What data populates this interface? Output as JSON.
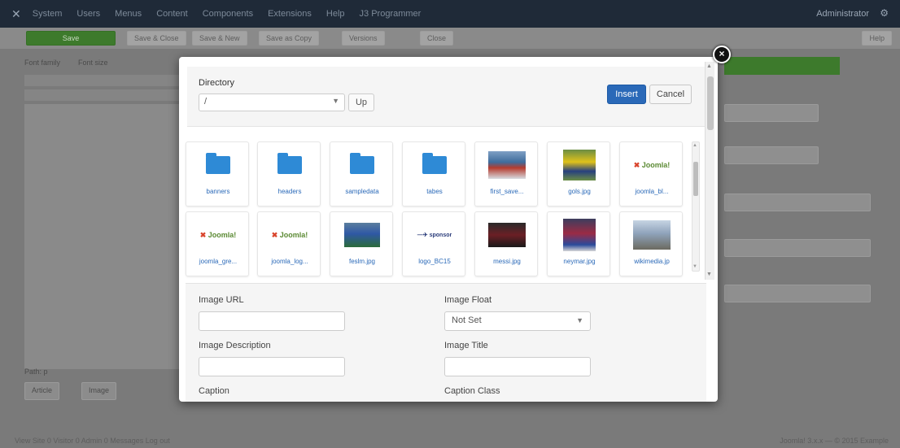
{
  "background": {
    "topbar": {
      "menus": [
        "System",
        "Users",
        "Menus",
        "Content",
        "Components",
        "Extensions",
        "Help",
        "J3 Programmer"
      ],
      "user": "Administrator"
    },
    "toolbar": {
      "save": "Save",
      "save_close": "Save & Close",
      "save_new": "Save & New",
      "save_copy": "Save as Copy",
      "versions": "Versions",
      "close": "Close",
      "help": "Help"
    },
    "editor": {
      "font_family": "Font family",
      "font_size": "Font size",
      "path": "Path: p"
    },
    "bottom_buttons": {
      "article": "Article",
      "image": "Image"
    },
    "footer": {
      "left": "View Site  0 Visitor  0 Admin  0 Messages  Log out",
      "right": "Joomla! 3.x.x — © 2015 Example"
    }
  },
  "modal": {
    "directory_label": "Directory",
    "directory_value": "/",
    "up_label": "Up",
    "insert_label": "Insert",
    "cancel_label": "Cancel",
    "items": [
      {
        "name": "banners",
        "kind": "folder"
      },
      {
        "name": "headers",
        "kind": "folder"
      },
      {
        "name": "sampledata",
        "kind": "folder"
      },
      {
        "name": "tabes",
        "kind": "folder"
      },
      {
        "name": "first_save...",
        "kind": "image",
        "style": "img-a"
      },
      {
        "name": "gols.jpg",
        "kind": "image",
        "style": "img-b"
      },
      {
        "name": "joomla_bl...",
        "kind": "logo-j"
      },
      {
        "name": "joomla_gre...",
        "kind": "logo-j"
      },
      {
        "name": "joomla_log...",
        "kind": "logo-j"
      },
      {
        "name": "feslm.jpg",
        "kind": "image",
        "style": "img-d"
      },
      {
        "name": "logo_BC15",
        "kind": "sponsor"
      },
      {
        "name": "messi.jpg",
        "kind": "image",
        "style": "img-e"
      },
      {
        "name": "neymar.jpg",
        "kind": "image",
        "style": "img-f"
      },
      {
        "name": "wikimedia.jp",
        "kind": "image",
        "style": "img-g"
      }
    ],
    "logo_text": "Joomla!",
    "sponsor_text": "sponsor",
    "form": {
      "image_url_label": "Image URL",
      "image_float_label": "Image Float",
      "image_float_value": "Not Set",
      "image_desc_label": "Image Description",
      "image_title_label": "Image Title",
      "caption_label": "Caption",
      "caption_class_label": "Caption Class"
    },
    "close_icon": "×"
  }
}
